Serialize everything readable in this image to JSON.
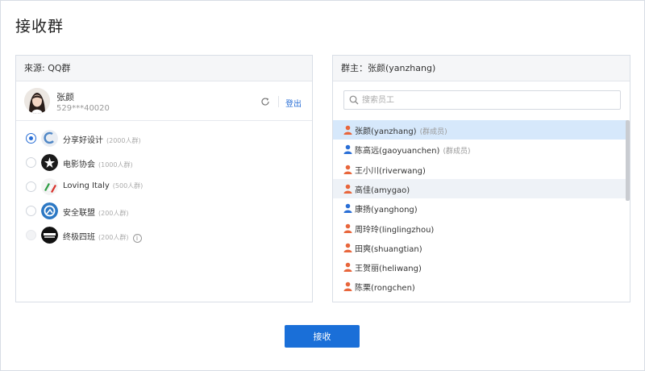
{
  "page": {
    "title": "接收群"
  },
  "left_panel": {
    "header": "來源: QQ群",
    "account": {
      "name": "张颜",
      "id": "529***40020",
      "logout_label": "登出"
    },
    "groups": [
      {
        "name": "分享好设计",
        "count": "(2000人群)",
        "state": "checked"
      },
      {
        "name": "电影协会",
        "count": "(1000人群)",
        "state": "unchecked"
      },
      {
        "name": "Loving Italy",
        "count": "(500人群)",
        "state": "unchecked"
      },
      {
        "name": "安全联盟",
        "count": "(200人群)",
        "state": "unchecked"
      },
      {
        "name": "终极四班",
        "count": "(200人群)",
        "state": "disabled",
        "info": "i"
      }
    ]
  },
  "right_panel": {
    "header": "群主：张颜(yanzhang)",
    "search": {
      "placeholder": "搜索员工",
      "value": ""
    },
    "members": [
      {
        "name": "张颜(yanzhang)",
        "tag": "(群成员)",
        "icon_color": "#e8663c",
        "state": "selected"
      },
      {
        "name": "陈高远(gaoyuanchen)",
        "tag": "(群成员)",
        "icon_color": "#2a6fd6",
        "state": "normal"
      },
      {
        "name": "王小川(riverwang)",
        "tag": "",
        "icon_color": "#e8663c",
        "state": "normal"
      },
      {
        "name": "高佳(amygao)",
        "tag": "",
        "icon_color": "#e8663c",
        "state": "hover"
      },
      {
        "name": "康扬(yanghong)",
        "tag": "",
        "icon_color": "#2a6fd6",
        "state": "normal"
      },
      {
        "name": "周玲玲(linglingzhou)",
        "tag": "",
        "icon_color": "#e8663c",
        "state": "normal"
      },
      {
        "name": "田爽(shuangtian)",
        "tag": "",
        "icon_color": "#e8663c",
        "state": "normal"
      },
      {
        "name": "王贺丽(heliwang)",
        "tag": "",
        "icon_color": "#e8663c",
        "state": "normal"
      },
      {
        "name": "陈栗(rongchen)",
        "tag": "",
        "icon_color": "#e8663c",
        "state": "normal"
      }
    ]
  },
  "actions": {
    "submit_label": "接收"
  },
  "colors": {
    "accent": "#1a6fd8",
    "selected_row": "#d6e8fb"
  },
  "icons": {
    "refresh": "refresh-icon",
    "search": "search-icon",
    "member_male": "user-icon-blue",
    "member_female": "user-icon-orange"
  }
}
